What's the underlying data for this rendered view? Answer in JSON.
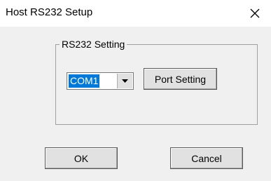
{
  "window": {
    "title": "Host RS232 Setup"
  },
  "group": {
    "label": "RS232 Setting"
  },
  "port_select": {
    "value": "COM1"
  },
  "buttons": {
    "port_setting": "Port Setting",
    "ok": "OK",
    "cancel": "Cancel"
  },
  "icons": {
    "close": "close-icon",
    "dropdown": "chevron-down-icon"
  },
  "colors": {
    "selection": "#0078d7",
    "background": "#f0f0f0",
    "titlebar": "#ffffff"
  }
}
